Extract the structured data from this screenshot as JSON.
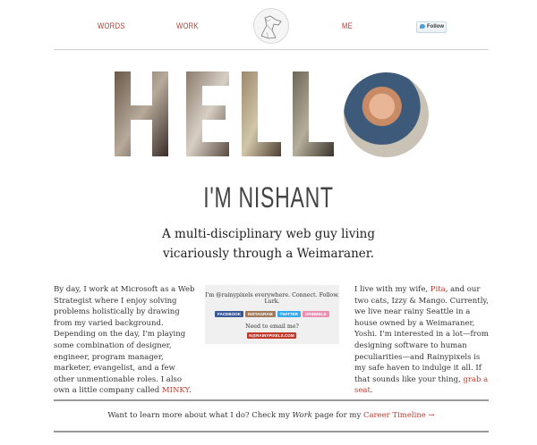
{
  "nav": {
    "words": "WORDS",
    "work": "WORK",
    "me": "ME",
    "follow": "Follow"
  },
  "hero": {
    "letters": [
      "H",
      "E",
      "L",
      "L",
      "O"
    ],
    "name": "I'M NISHANT",
    "tagline": "A multi-disciplinary web guy living vicariously through a Weimaraner."
  },
  "left_col": {
    "text1": "By day, I work at Microsoft as a Web Strategist where I enjoy solving problems holistically by drawing from my varied background. Depending on the day, I'm playing some combination of designer, engineer, program manager, marketer, evangelist, and a few other unmentionable roles. I also own a little company called ",
    "link": "MINKY",
    "text2": "."
  },
  "social_box": {
    "line1": "I'm @rainypixels everywhere. Connect. Follow. Lurk.",
    "badges": [
      {
        "label": "FACEBOOK",
        "color": "#3b5998"
      },
      {
        "label": "INSTAGRAM",
        "color": "#a07a5a"
      },
      {
        "label": "TWITTER",
        "color": "#33aaf0"
      },
      {
        "label": "DRIBBBLE",
        "color": "#ea8fb2"
      }
    ],
    "line2": "Need to email me?",
    "email": "N@RAINYPIXELS.COM"
  },
  "right_col": {
    "t1": "I live with my wife, ",
    "wife": "Pita",
    "t2": ", and our two cats, Izzy & Mango. Currently, we live near rainy Seattle in a house owned by a Weimaraner, Yoshi. I'm interested in a lot—from designing software to human peculiarities—and Rainypixels is my safe haven to indulge it all. If that sounds like your thing, ",
    "link": "grab a seat",
    "t3": "."
  },
  "footer": {
    "t1": "Want to learn more about what I do? Check my ",
    "work": "Work",
    "t2": " page for my ",
    "link": "Career Timeline",
    "arrow": "→"
  },
  "colors": {
    "accent": "#c0392b",
    "rule": "#cfcfcf",
    "box": "#f0f0f0"
  }
}
